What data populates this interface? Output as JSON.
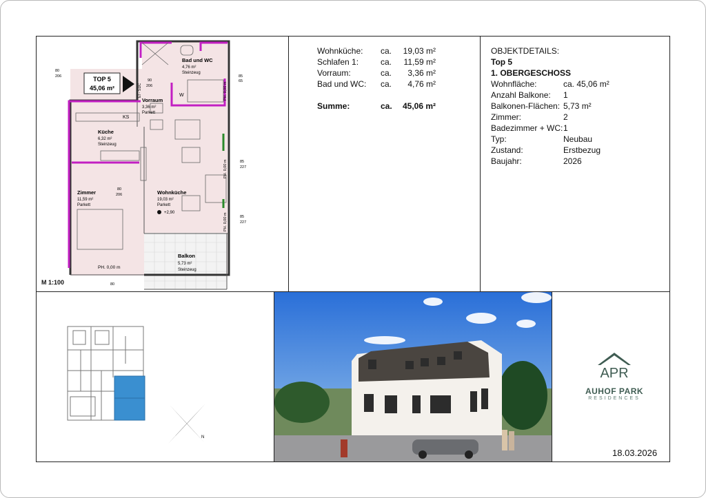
{
  "rooms": [
    {
      "label": "Wohnküche:",
      "ca": "ca.",
      "value": "19,03 m²"
    },
    {
      "label": "Schlafen 1:",
      "ca": "ca.",
      "value": "11,59 m²"
    },
    {
      "label": "Vorraum:",
      "ca": "ca.",
      "value": "3,36 m²"
    },
    {
      "label": "Bad und WC:",
      "ca": "ca.",
      "value": "4,76 m²"
    }
  ],
  "sum": {
    "label": "Summe:",
    "ca": "ca.",
    "value": "45,06 m²"
  },
  "details": {
    "heading": "OBJEKTDETAILS:",
    "unit": "Top 5",
    "floor": "1. OBERGESCHOSS",
    "rows": [
      {
        "label": "Wohnfläche:",
        "value": "ca. 45,06 m²"
      },
      {
        "label": "Anzahl Balkone:",
        "value": "1"
      },
      {
        "label": "Balkonen-Flächen:",
        "value": "5,73 m²"
      },
      {
        "label": "Zimmer:",
        "value": "2"
      },
      {
        "label": "Badezimmer + WC:",
        "value": "1"
      },
      {
        "label": "Typ:",
        "value": "Neubau"
      },
      {
        "label": "Zustand:",
        "value": "Erstbezug"
      },
      {
        "label": "Baujahr:",
        "value": "2026"
      }
    ]
  },
  "plan": {
    "scale": "M 1:100",
    "top_label": "TOP 5",
    "top_area": "45,06 m²",
    "bad_name": "Bad und WC",
    "bad_area": "4,76 m²",
    "bad_floor": "Steinzeug",
    "vorraum_name": "Vorraum",
    "vorraum_area": "3,36 m²",
    "vorraum_floor": "Parkett",
    "kueche_name": "Küche",
    "kueche_area": "6,32 m²",
    "kueche_floor": "Steinzeug",
    "zimmer_name": "Zimmer",
    "zimmer_area": "11,59 m²",
    "zimmer_floor": "Parkett",
    "wohn_name": "Wohnküche",
    "wohn_area": "19,03 m²",
    "wohn_floor": "Parkett",
    "wohn_level": "+2,90",
    "balkon_name": "Balkon",
    "balkon_area": "5,73 m²",
    "balkon_floor": "Steinzeug",
    "ks": "KS",
    "w": "W",
    "ph": "PH. 0,00 m",
    "door_80": "80",
    "door_206": "206",
    "door_90": "90",
    "win_85": "85",
    "win_227": "227",
    "win_65": "65",
    "el": "El - SDC"
  },
  "logo": {
    "brand": "AUHOF PARK",
    "sub": "RESIDENCES",
    "mark": "APR"
  },
  "date": "18.03.2026",
  "colors": {
    "accent_wall": "#c21fc2",
    "highlight_unit": "#3a8fd0",
    "logo_green": "#3f5c52"
  }
}
